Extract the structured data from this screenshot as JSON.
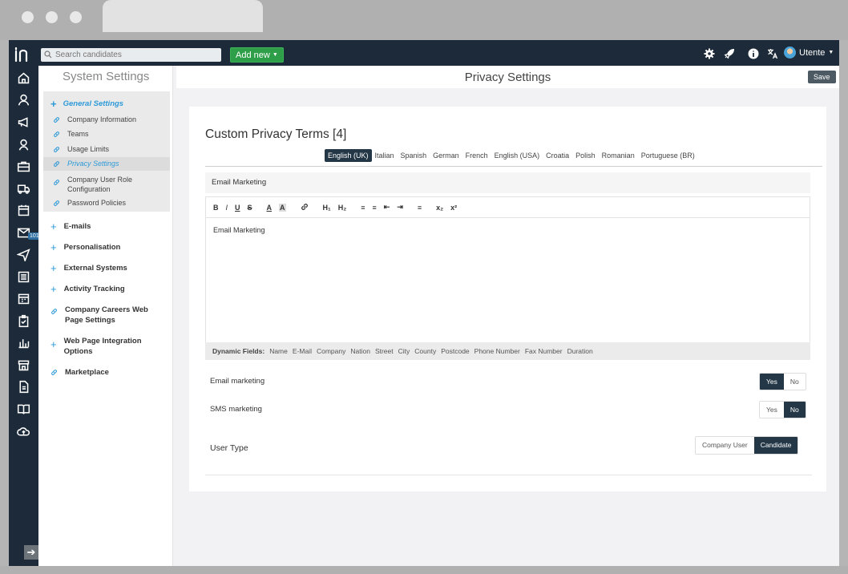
{
  "topbar": {
    "search_placeholder": "Search candidates",
    "add_new_label": "Add new",
    "user_name": "Utente"
  },
  "rail": {
    "mail_badge": "101"
  },
  "nav": {
    "title": "System Settings",
    "general": {
      "label": "General Settings",
      "items": [
        "Company Information",
        "Teams",
        "Usage Limits",
        "Privacy Settings",
        "Company User Role Configuration",
        "Password Policies"
      ]
    },
    "sections": [
      "E-mails",
      "Personalisation",
      "External Systems",
      "Activity Tracking",
      "Company Careers Web Page Settings",
      "Web Page Integration Options",
      "Marketplace"
    ]
  },
  "main": {
    "title": "Privacy Settings",
    "save_label": "Save",
    "card_title": "Custom Privacy Terms [4]",
    "languages": [
      "English (UK)",
      "Italian",
      "Spanish",
      "German",
      "French",
      "English (USA)",
      "Croatia",
      "Polish",
      "Romanian",
      "Portuguese (BR)"
    ],
    "active_language": "English (UK)",
    "subject": "Email Marketing",
    "toolbar": [
      "B",
      "I",
      "U",
      "S",
      "A",
      "A",
      "🔗",
      "H₁",
      "H₂",
      "≡",
      "≡",
      "⇤",
      "⇥",
      "≡",
      "x₂",
      "x²"
    ],
    "body": "Email Marketing",
    "dynamic_label": "Dynamic Fields:",
    "dynamic_fields": [
      "Name",
      "E-Mail",
      "Company",
      "Nation",
      "Street",
      "City",
      "County",
      "Postcode",
      "Phone Number",
      "Fax Number",
      "Duration"
    ],
    "email_marketing": {
      "label": "Email marketing",
      "yes": "Yes",
      "no": "No",
      "value": "Yes"
    },
    "sms_marketing": {
      "label": "SMS marketing",
      "yes": "Yes",
      "no": "No",
      "value": "No"
    },
    "user_type": {
      "label": "User Type",
      "options": [
        "Company User",
        "Candidate"
      ],
      "value": "Candidate"
    }
  },
  "colors": {
    "rail": "#1c2a39",
    "accent": "#2d9ad8",
    "toggle_on": "#233746",
    "add_new": "#2e9e48"
  }
}
